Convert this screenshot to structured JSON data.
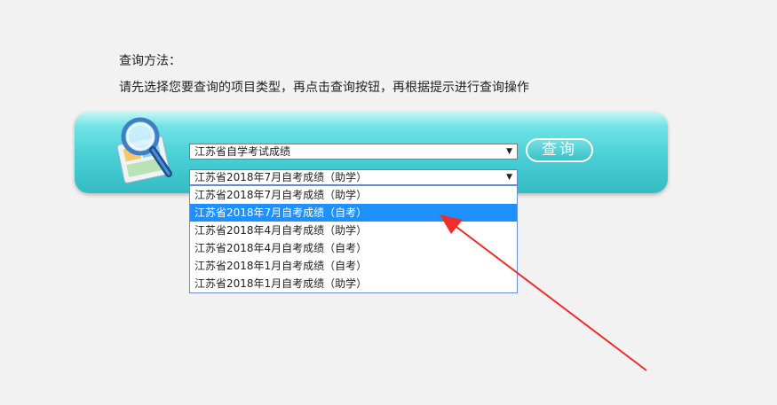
{
  "instructions": {
    "heading": "查询方法：",
    "text": "请先选择您要查询的项目类型，再点击查询按钮，再根据提示进行查询操作"
  },
  "search": {
    "category_select": "江苏省自学考试成绩",
    "project_select": "江苏省2018年7月自考成绩（助学）",
    "query_button": "查询",
    "options": [
      {
        "label": "江苏省2018年7月自考成绩（助学）",
        "selected": false
      },
      {
        "label": "江苏省2018年7月自考成绩（自考）",
        "selected": true
      },
      {
        "label": "江苏省2018年4月自考成绩（助学）",
        "selected": false
      },
      {
        "label": "江苏省2018年4月自考成绩（自考）",
        "selected": false
      },
      {
        "label": "江苏省2018年1月自考成绩（自考）",
        "selected": false
      },
      {
        "label": "江苏省2018年1月自考成绩（助学）",
        "selected": false
      }
    ]
  },
  "colors": {
    "panel": "#49cfd5",
    "selected_option": "#1e90ff",
    "annotation_arrow": "#f02d2d"
  },
  "icons": [
    "magnifier-icon",
    "dropdown-arrow-icon",
    "annotation-arrow"
  ]
}
